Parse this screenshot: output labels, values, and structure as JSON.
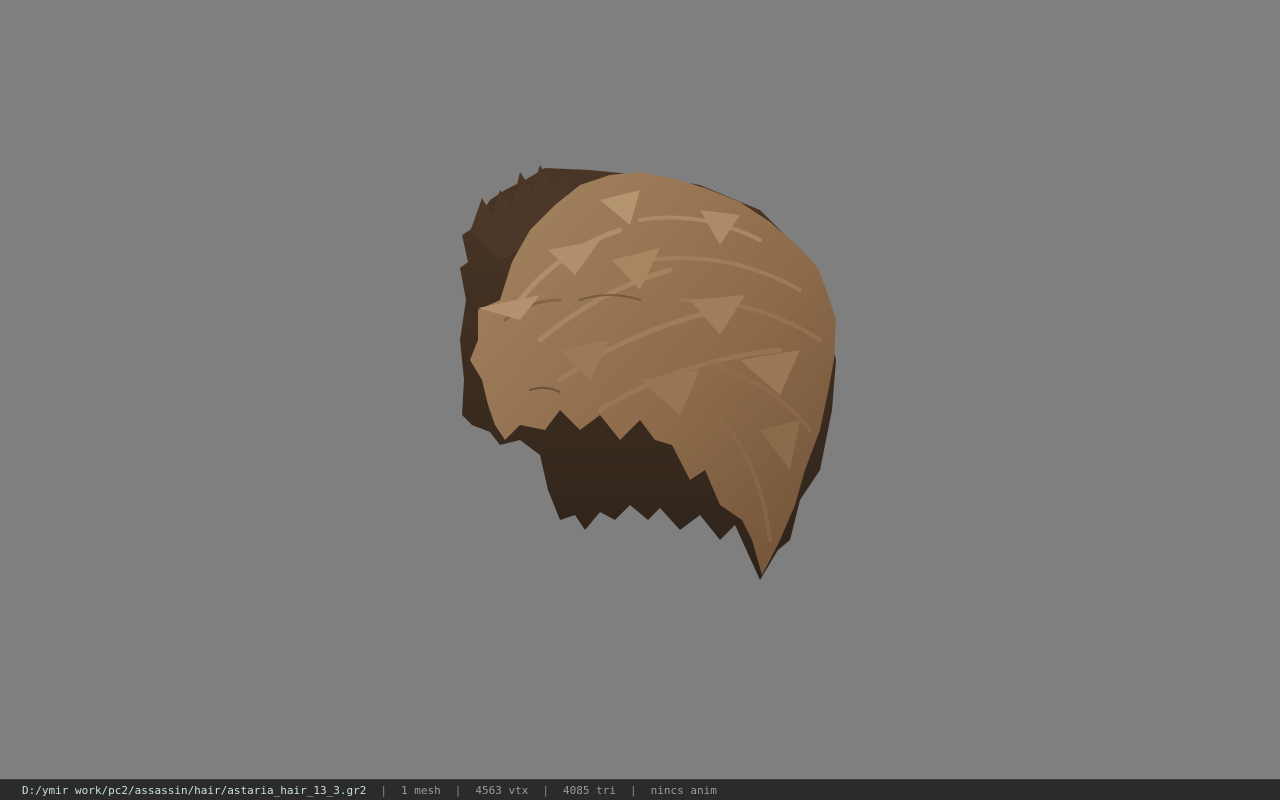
{
  "model": {
    "subject": "hair-mesh",
    "colors": {
      "light": "#9c7b5a",
      "mid": "#7a5b3d",
      "dark": "#3e2e21",
      "shadow": "#2d2219"
    }
  },
  "status": {
    "path": "D:/ymir work/pc2/assassin/hair/astaria_hair_13_3.gr2",
    "separator": "|",
    "mesh": "1 mesh",
    "vtx": "4563 vtx",
    "tri": "4085 tri",
    "anim": "nincs anim"
  }
}
